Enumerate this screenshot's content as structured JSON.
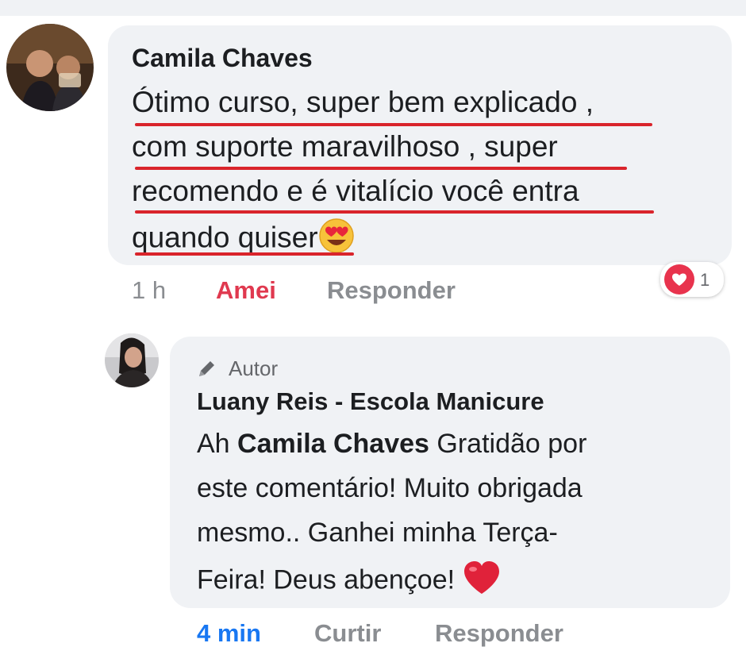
{
  "comment": {
    "author": "Camila Chaves",
    "lines": [
      "Ótimo curso, super bem explicado ,",
      "com suporte maravilhoso , super",
      "recomendo e é vitalício você entra",
      "quando quiser"
    ],
    "time": "1 h",
    "reaction_label": "Amei",
    "reply_label": "Responder",
    "reaction_count": "1",
    "reaction_icon": "heart-icon",
    "emoji": "heart-eyes-emoji"
  },
  "reply": {
    "badge": "Autor",
    "badge_icon": "pencil-icon",
    "author": "Luany Reis - Escola Manicure",
    "prefix": "Ah ",
    "mention": "Camila Chaves",
    "lines": [
      " Gratidão por",
      "este comentário! Muito obrigada",
      "mesmo.. Ganhei minha Terça-",
      "Feira! Deus abençoe! "
    ],
    "time": "4 min",
    "like_label": "Curtir",
    "reply_label": "Responder",
    "emoji": "red-heart-emoji"
  },
  "colors": {
    "underline": "#d9242b",
    "amei": "#e0394f",
    "time_link": "#1877f2",
    "bubble": "#f0f2f5"
  }
}
